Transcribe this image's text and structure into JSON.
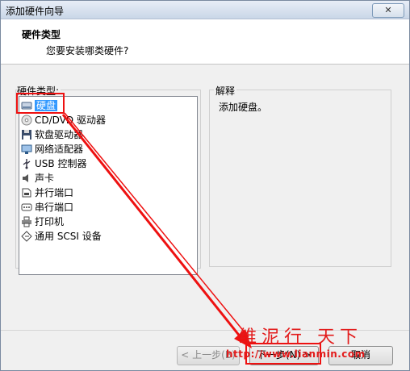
{
  "window": {
    "title": "添加硬件向导",
    "close_glyph": "✕"
  },
  "header": {
    "title": "硬件类型",
    "subtitle": "您要安装哪类硬件?"
  },
  "hardware_list": {
    "label": "硬件类型:",
    "items": [
      {
        "label": "硬盘",
        "icon": "hard-disk-icon",
        "selected": true
      },
      {
        "label": "CD/DVD 驱动器",
        "icon": "cd-dvd-icon"
      },
      {
        "label": "软盘驱动器",
        "icon": "floppy-icon"
      },
      {
        "label": "网络适配器",
        "icon": "network-adapter-icon"
      },
      {
        "label": "USB 控制器",
        "icon": "usb-icon"
      },
      {
        "label": "声卡",
        "icon": "sound-card-icon"
      },
      {
        "label": "并行端口",
        "icon": "parallel-port-icon"
      },
      {
        "label": "串行端口",
        "icon": "serial-port-icon"
      },
      {
        "label": "打印机",
        "icon": "printer-icon"
      },
      {
        "label": "通用 SCSI 设备",
        "icon": "scsi-icon"
      }
    ]
  },
  "explanation": {
    "label": "解释",
    "text": "添加硬盘。"
  },
  "buttons": {
    "back": "< 上一步(B)",
    "next": "下一步(N) >",
    "cancel": "取消"
  },
  "watermark": {
    "chars": "维泥行 天下",
    "url": "http://www.lianmin.com"
  },
  "colors": {
    "selection": "#3399ff",
    "annotation_red": "#ee1111"
  }
}
